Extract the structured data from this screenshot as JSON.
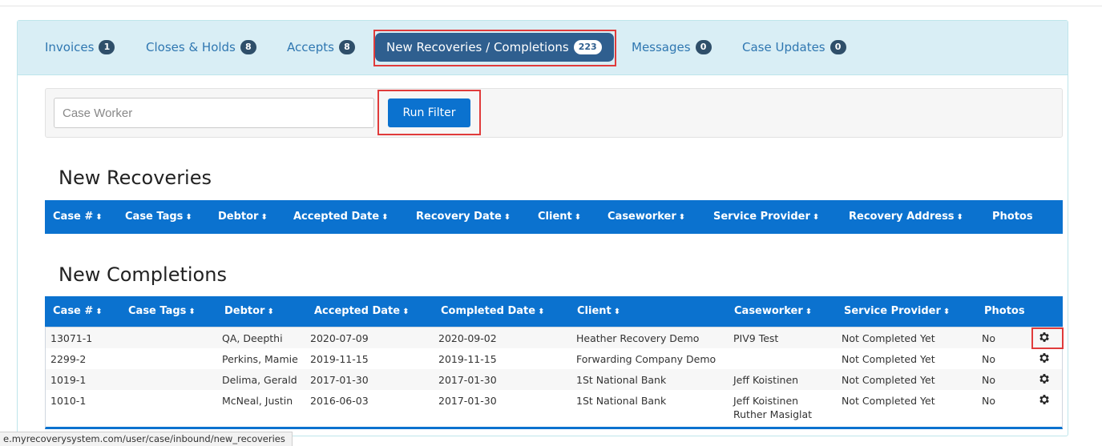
{
  "tabs": [
    {
      "label": "Invoices",
      "count": "1"
    },
    {
      "label": "Closes & Holds",
      "count": "8"
    },
    {
      "label": "Accepts",
      "count": "8"
    },
    {
      "label": "New Recoveries / Completions",
      "count": "223"
    },
    {
      "label": "Messages",
      "count": "0"
    },
    {
      "label": "Case Updates",
      "count": "0"
    }
  ],
  "filter": {
    "placeholder": "Case Worker",
    "value": "",
    "run_label": "Run Filter"
  },
  "recoveries": {
    "title": "New Recoveries",
    "columns": [
      "Case #",
      "Case Tags",
      "Debtor",
      "Accepted Date",
      "Recovery Date",
      "Client",
      "Caseworker",
      "Service Provider",
      "Recovery Address",
      "Photos"
    ]
  },
  "completions": {
    "title": "New Completions",
    "columns": [
      "Case #",
      "Case Tags",
      "Debtor",
      "Accepted Date",
      "Completed Date",
      "Client",
      "Caseworker",
      "Service Provider",
      "Photos"
    ],
    "rows": [
      {
        "case": "13071-1",
        "tags": "",
        "debtor": "QA, Deepthi",
        "accepted": "2020-07-09",
        "completed": "2020-09-02",
        "client": "Heather Recovery Demo",
        "caseworker": [
          "PIV9 Test"
        ],
        "provider": "Not Completed Yet",
        "photos": "No"
      },
      {
        "case": "2299-2",
        "tags": "",
        "debtor": "Perkins, Mamie",
        "accepted": "2019-11-15",
        "completed": "2019-11-15",
        "client": "Forwarding Company Demo",
        "caseworker": [],
        "provider": "Not Completed Yet",
        "photos": "No"
      },
      {
        "case": "1019-1",
        "tags": "",
        "debtor": "Delima, Gerald",
        "accepted": "2017-01-30",
        "completed": "2017-01-30",
        "client": "1St National Bank",
        "caseworker": [
          "Jeff Koistinen"
        ],
        "provider": "Not Completed Yet",
        "photos": "No"
      },
      {
        "case": "1010-1",
        "tags": "",
        "debtor": "McNeal, Justin",
        "accepted": "2016-06-03",
        "completed": "2017-01-30",
        "client": "1St National Bank",
        "caseworker": [
          "Jeff Koistinen",
          "Ruther Masiglat"
        ],
        "provider": "Not Completed Yet",
        "photos": "No"
      }
    ]
  },
  "status_url": "e.myrecoverysystem.com/user/case/inbound/new_recoveries",
  "icons": {
    "sort": "sort-arrows-icon",
    "row_action": "gear-icon"
  },
  "colors": {
    "header_blue": "#0b72cf",
    "tab_bar": "#d9eef5",
    "active_tab": "#2f5f8f",
    "highlight": "#e03b3b"
  }
}
